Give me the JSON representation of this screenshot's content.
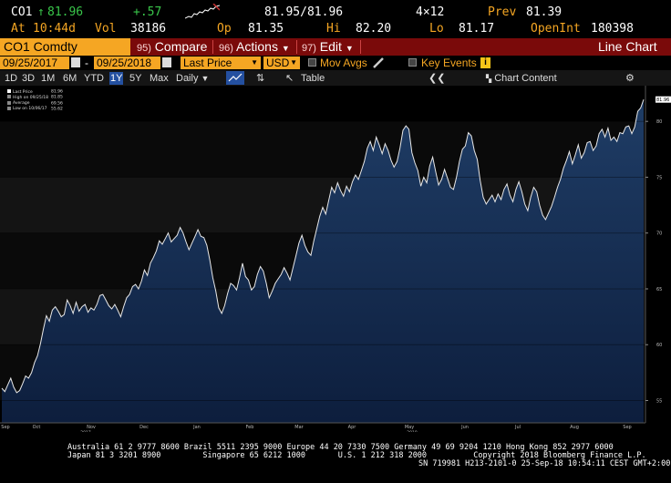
{
  "quote": {
    "ticker": "CO1",
    "last_arrow": "↑",
    "last": "81.96",
    "change": "+.57",
    "bid_ask": "81.95/81.96",
    "size": "4×12",
    "prev_label": "Prev",
    "prev": "81.39",
    "at_label": "At",
    "time": "10:44d",
    "vol_label": "Vol",
    "vol": "38186",
    "open_label": "Op",
    "open": "81.35",
    "hi_label": "Hi",
    "hi": "82.20",
    "lo_label": "Lo",
    "lo": "81.17",
    "oi_label": "OpenInt",
    "oi": "180398"
  },
  "titlebar": {
    "security": "CO1 Comdty",
    "compare_num": "95)",
    "compare": "Compare",
    "actions_num": "96)",
    "actions": "Actions",
    "edit_num": "97)",
    "edit": "Edit",
    "chart_type": "Line Chart"
  },
  "toolbar": {
    "start_date": "09/25/2017",
    "end_date": "09/25/2018",
    "field": "Last Price",
    "currency": "USD",
    "mov_avgs": "Mov Avgs",
    "key_events": "Key Events",
    "info_icon": "i"
  },
  "periods": {
    "items": [
      "1D",
      "3D",
      "1M",
      "6M",
      "YTD",
      "1Y",
      "5Y",
      "Max"
    ],
    "selected": "1Y",
    "frequency": "Daily",
    "table": "Table",
    "chart_content": "Chart Content"
  },
  "legend": {
    "items": [
      {
        "label": "Last Price",
        "value": "81.96",
        "color": "#ffffff"
      },
      {
        "label": "High on 09/25/18",
        "value": "81.85",
        "color": "#888888"
      },
      {
        "label": "Average",
        "value": "69.56",
        "color": "#888888"
      },
      {
        "label": "Low on 10/06/17",
        "value": "55.62",
        "color": "#888888"
      }
    ]
  },
  "chart_data": {
    "type": "area",
    "y_ticks": [
      55,
      60,
      65,
      70,
      75,
      80
    ],
    "ylim": [
      53,
      83.2
    ],
    "last_value_label": "81.96",
    "x_labels": [
      "Sep",
      "Oct",
      "Nov",
      "Dec",
      "Jan",
      "Feb",
      "Mar",
      "Apr",
      "May",
      "Jun",
      "Jul",
      "Aug",
      "Sep"
    ],
    "year_labels": [
      "2017",
      "2018"
    ],
    "series": [
      {
        "values": [
          56.1,
          55.8,
          56.4,
          57.0,
          56.2,
          55.7,
          55.9,
          56.5,
          57.2,
          57.0,
          57.5,
          58.4,
          59.0,
          60.1,
          61.4,
          62.6,
          62.1,
          63.1,
          63.4,
          63.0,
          62.5,
          62.7,
          64.0,
          63.5,
          62.8,
          63.8,
          63.0,
          63.4,
          63.6,
          62.9,
          63.3,
          63.1,
          63.6,
          64.4,
          64.5,
          64.0,
          63.5,
          63.2,
          63.6,
          63.1,
          62.5,
          63.4,
          64.2,
          64.5,
          65.2,
          65.4,
          65.0,
          65.7,
          66.7,
          66.2,
          67.3,
          67.8,
          68.4,
          69.3,
          69.0,
          69.5,
          70.0,
          69.2,
          69.5,
          69.8,
          70.5,
          70.0,
          69.2,
          68.5,
          69.1,
          69.7,
          70.3,
          69.7,
          69.6,
          68.9,
          67.6,
          66.0,
          64.8,
          63.3,
          62.8,
          63.5,
          64.6,
          65.5,
          65.3,
          64.9,
          66.0,
          67.3,
          66.1,
          65.8,
          64.9,
          65.2,
          66.3,
          67.0,
          66.6,
          65.5,
          64.2,
          64.8,
          65.5,
          65.9,
          66.3,
          66.9,
          66.4,
          65.8,
          66.9,
          68.0,
          69.1,
          69.8,
          68.9,
          68.3,
          68.0,
          69.3,
          70.4,
          71.5,
          72.3,
          71.7,
          72.9,
          74.1,
          73.6,
          74.5,
          73.8,
          73.3,
          74.2,
          73.7,
          74.6,
          75.2,
          74.8,
          75.6,
          76.4,
          77.6,
          78.2,
          77.4,
          78.6,
          77.9,
          77.1,
          78.0,
          77.4,
          76.5,
          75.9,
          76.4,
          77.6,
          79.2,
          79.6,
          79.3,
          77.2,
          76.3,
          75.6,
          74.2,
          75.0,
          74.5,
          76.0,
          76.8,
          75.5,
          74.3,
          74.8,
          75.7,
          74.9,
          74.1,
          73.9,
          75.0,
          76.4,
          77.5,
          77.8,
          79.0,
          78.7,
          77.4,
          76.6,
          74.7,
          73.2,
          72.6,
          73.0,
          73.4,
          72.8,
          73.5,
          73.0,
          73.9,
          74.4,
          73.4,
          72.8,
          73.9,
          74.6,
          73.7,
          72.6,
          72.0,
          73.2,
          74.1,
          73.7,
          72.5,
          71.6,
          71.2,
          71.8,
          72.4,
          73.2,
          74.1,
          74.8,
          75.8,
          76.5,
          77.3,
          76.2,
          77.0,
          77.9,
          76.7,
          77.2,
          78.1,
          78.2,
          77.4,
          77.8,
          78.9,
          79.3,
          78.6,
          79.4,
          78.3,
          78.6,
          78.2,
          79.0,
          78.9,
          79.5,
          79.6,
          78.9,
          79.5,
          80.9,
          81.2,
          81.96
        ]
      }
    ]
  },
  "footer": {
    "line1": "Australia 61 2 9777 8600 Brazil 5511 2395 9000 Europe 44 20 7330 7500 Germany 49 69 9204 1210 Hong Kong 852 2977 6000",
    "line2": "Japan 81 3 3201 8900         Singapore 65 6212 1000       U.S. 1 212 318 2000          Copyright 2018 Bloomberg Finance L.P.",
    "line3": "SN 719981 H213-2101-0 25-Sep-18 10:54:11 CEST GMT+2:00"
  }
}
